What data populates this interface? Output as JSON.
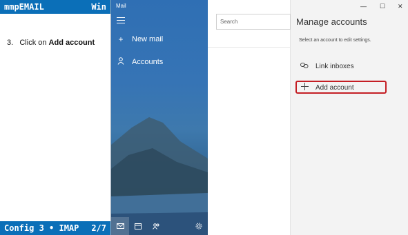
{
  "guide": {
    "brand": "mmpEMAIL",
    "platform": "Win",
    "step_number": "3.",
    "step_prefix": "Click on",
    "step_action": "Add account",
    "footer_left": "Config 3 • IMAP",
    "footer_right": "2/7"
  },
  "app": {
    "title": "Mail",
    "nav": {
      "menu_icon": "hamburger-icon",
      "items": [
        {
          "label": "New mail",
          "icon": "plus-icon"
        },
        {
          "label": "Accounts",
          "icon": "person-icon"
        }
      ],
      "bottom_icons": [
        "mail-icon",
        "calendar-icon",
        "people-icon",
        "settings-icon"
      ]
    },
    "list": {
      "search_placeholder": "Search"
    },
    "pane": {
      "title": "Manage accounts",
      "description": "Select an account to edit settings.",
      "items": [
        {
          "label": "Link inboxes",
          "icon": "link-icon"
        },
        {
          "label": "Add account",
          "icon": "plus-icon",
          "highlighted": true
        }
      ],
      "highlight_color": "#c41e24"
    },
    "window_controls": [
      "minimize-icon",
      "maximize-icon",
      "close-icon"
    ],
    "accent": "#2f6fb4"
  }
}
